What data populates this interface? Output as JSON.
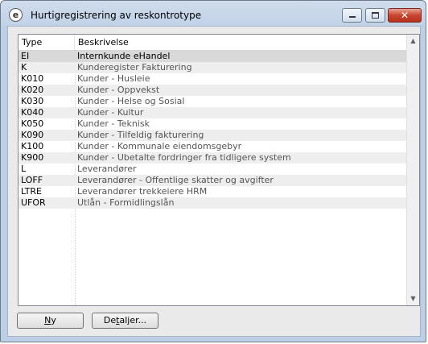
{
  "window": {
    "title": "Hurtigregistrering av reskontrotype",
    "app_icon": "e",
    "icons": {
      "app": "e-logo-icon",
      "minimize": "minimize-icon",
      "maximize": "maximize-icon",
      "close": "close-icon"
    },
    "close_glyph": "✕"
  },
  "list": {
    "columns": {
      "type": "Type",
      "description": "Beskrivelse"
    },
    "selected_index": 0,
    "rows": [
      {
        "type": "EI",
        "description": "Internkunde eHandel"
      },
      {
        "type": "K",
        "description": "Kunderegister Fakturering"
      },
      {
        "type": "K010",
        "description": "Kunder - Husleie"
      },
      {
        "type": "K020",
        "description": "Kunder - Oppvekst"
      },
      {
        "type": "K030",
        "description": "Kunder - Helse og Sosial"
      },
      {
        "type": "K040",
        "description": "Kunder - Kultur"
      },
      {
        "type": "K050",
        "description": "Kunder - Teknisk"
      },
      {
        "type": "K090",
        "description": "Kunder - Tilfeldig fakturering"
      },
      {
        "type": "K100",
        "description": "Kunder - Kommunale eiendomsgebyr"
      },
      {
        "type": "K900",
        "description": "Kunder - Ubetalte fordringer fra tidligere system"
      },
      {
        "type": "L",
        "description": "Leverandører"
      },
      {
        "type": "LOFF",
        "description": "Leverandører - Offentlige skatter og avgifter"
      },
      {
        "type": "LTRE",
        "description": "Leverandører trekkeiere HRM"
      },
      {
        "type": "UFOR",
        "description": "Utlån - Formidlingslån"
      }
    ]
  },
  "scrollbar": {
    "up_arrow": "▲",
    "down_arrow": "▼"
  },
  "buttons": {
    "new": {
      "underlined": "N",
      "rest": "y"
    },
    "details": {
      "prefix": "De",
      "underlined": "t",
      "rest": "aljer..."
    }
  }
}
